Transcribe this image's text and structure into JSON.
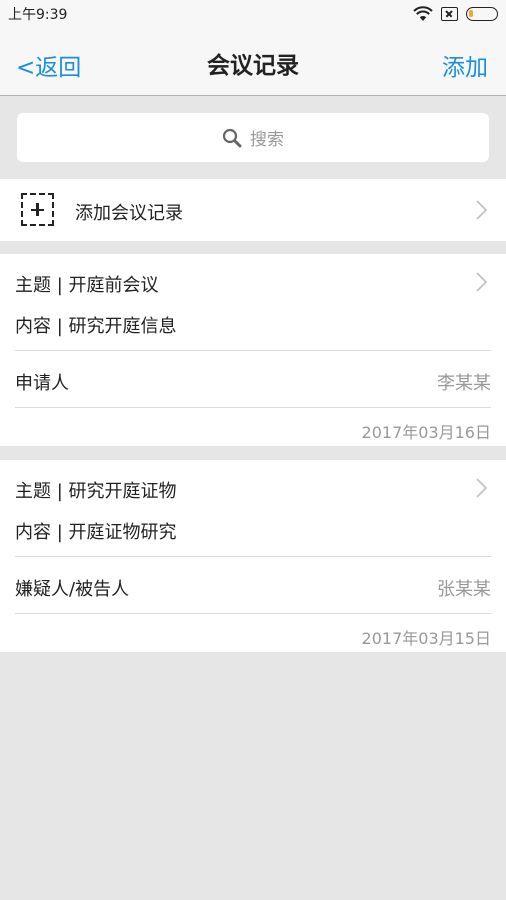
{
  "status_bar": {
    "time": "上午9:39"
  },
  "nav": {
    "back_label": "<返回",
    "title": "会议记录",
    "add_label": "添加"
  },
  "search": {
    "placeholder": "搜索"
  },
  "add_record": {
    "label": "添加会议记录"
  },
  "records": [
    {
      "subject": "主题 | 开庭前会议",
      "content": "内容 | 研究开庭信息",
      "role": "申请人",
      "name": "李某某",
      "date": "2017年03月16日"
    },
    {
      "subject": "主题 | 研究开庭证物",
      "content": "内容 | 开庭证物研究",
      "role": "嫌疑人/被告人",
      "name": "张某某",
      "date": "2017年03月15日"
    }
  ],
  "colors": {
    "accent": "#1a8fe0",
    "background": "#e6e6e6"
  }
}
